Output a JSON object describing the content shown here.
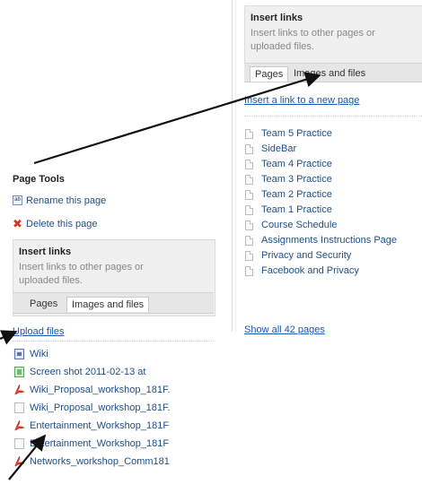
{
  "right_panel": {
    "insert_links_title": "Insert links",
    "insert_links_desc": "Insert links to other pages or uploaded files.",
    "tabs": [
      {
        "label": "Pages",
        "active": true
      },
      {
        "label": "Images and files",
        "active": false
      }
    ],
    "new_page_link": "Insert a link to a new page",
    "pages": [
      "Team 5 Practice",
      "SideBar",
      "Team 4 Practice",
      "Team 3 Practice",
      "Team 2 Practice",
      "Team 1 Practice",
      "Course Schedule",
      "Assignments Instructions Page",
      "Privacy and Security",
      "Facebook and Privacy"
    ],
    "show_all": "Show all 42 pages"
  },
  "left_panel": {
    "page_tools_title": "Page Tools",
    "rename": "Rename this page",
    "delete": "Delete this page",
    "insert_links_title": "Insert links",
    "insert_links_desc": "Insert links to other pages or uploaded files.",
    "tabs": [
      {
        "label": "Pages",
        "active": false
      },
      {
        "label": "Images and files",
        "active": true
      }
    ],
    "upload": "Upload files",
    "files": [
      {
        "name": "Wiki",
        "icon": "wiki-icon"
      },
      {
        "name": "Screen shot 2011-02-13 at",
        "icon": "image-icon"
      },
      {
        "name": "Wiki_Proposal_workshop_181F.",
        "icon": "pdf-icon"
      },
      {
        "name": "Wiki_Proposal_workshop_181F.",
        "icon": "document-icon"
      },
      {
        "name": "Entertainment_Workshop_181F",
        "icon": "pdf-icon"
      },
      {
        "name": "Entertainment_Workshop_181F",
        "icon": "document-icon"
      },
      {
        "name": "Networks_workshop_Comm181",
        "icon": "pdf-icon"
      }
    ]
  },
  "colors": {
    "link": "#1a55b8",
    "arrow": "#111111",
    "pdf_icon": "#d8332a"
  }
}
